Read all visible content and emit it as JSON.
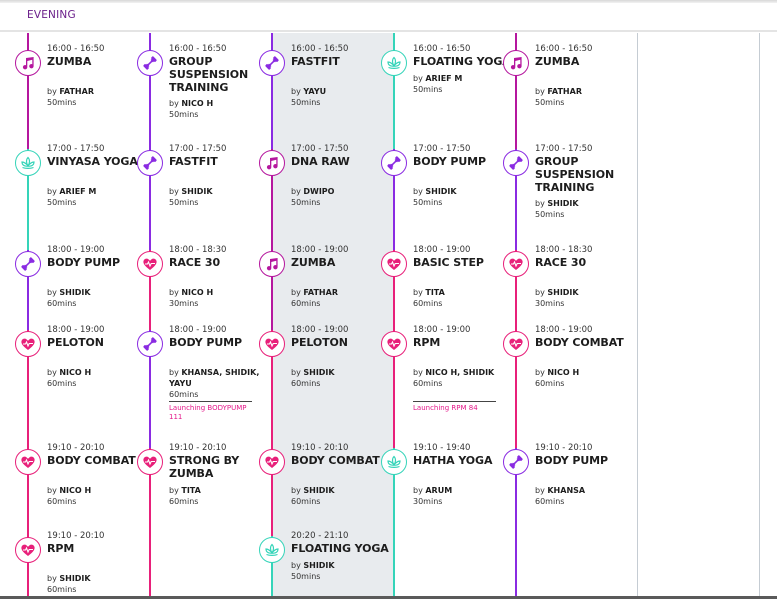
{
  "section": {
    "label": "EVENING"
  },
  "colors": {
    "pink": "#e8207a",
    "purple": "#8a2be2",
    "teal": "#35d4b9",
    "magenta": "#b5179e",
    "column_line": "#aab5c0",
    "highlight": "#e8ebee",
    "promo": "#e4188a"
  },
  "columns": [
    {
      "highlighted": false,
      "classes": [
        {
          "time": "16:00 - 16:50",
          "name": "ZUMBA",
          "by_prefix": "by",
          "instructor": "FATHAR",
          "duration": "50mins",
          "icon": "music-note-icon",
          "color": "#b5179e"
        },
        {
          "time": "17:00 - 17:50",
          "name": "VINYASA YOGA",
          "by_prefix": "by",
          "instructor": "ARIEF M",
          "duration": "50mins",
          "icon": "lotus-icon",
          "color": "#35d4b9"
        },
        {
          "time": "18:00 - 19:00",
          "name": "BODY PUMP",
          "by_prefix": "by",
          "instructor": "SHIDIK",
          "duration": "60mins",
          "icon": "dumbbell-icon",
          "color": "#8a2be2"
        },
        {
          "time": "18:00 - 19:00",
          "name": "PELOTON",
          "by_prefix": "by",
          "instructor": "NICO H",
          "duration": "60mins",
          "icon": "heart-pulse-icon",
          "color": "#e8207a"
        },
        {
          "time": "19:10 - 20:10",
          "name": "BODY COMBAT",
          "by_prefix": "by",
          "instructor": "NICO H",
          "duration": "60mins",
          "icon": "heart-pulse-icon",
          "color": "#e8207a"
        },
        {
          "time": "19:10 - 20:10",
          "name": "RPM",
          "by_prefix": "by",
          "instructor": "SHIDIK",
          "duration": "60mins",
          "icon": "heart-pulse-icon",
          "color": "#e8207a"
        }
      ]
    },
    {
      "highlighted": false,
      "classes": [
        {
          "time": "16:00 - 16:50",
          "name": "GROUP SUSPENSION TRAINING",
          "by_prefix": "by",
          "instructor": "NICO H",
          "duration": "50mins",
          "icon": "dumbbell-icon",
          "color": "#8a2be2"
        },
        {
          "time": "17:00 - 17:50",
          "name": "FASTFIT",
          "by_prefix": "by",
          "instructor": "SHIDIK",
          "duration": "50mins",
          "icon": "dumbbell-icon",
          "color": "#8a2be2"
        },
        {
          "time": "18:00 - 18:30",
          "name": "RACE 30",
          "by_prefix": "by",
          "instructor": "NICO H",
          "duration": "30mins",
          "icon": "heart-pulse-icon",
          "color": "#e8207a"
        },
        {
          "time": "18:00 - 19:00",
          "name": "BODY PUMP",
          "by_prefix": "by",
          "instructor": "KHANSA, SHIDIK, YAYU",
          "duration": "60mins",
          "icon": "dumbbell-icon",
          "color": "#8a2be2",
          "promo": "Launching BODYPUMP 111"
        },
        {
          "time": "19:10 - 20:10",
          "name": "STRONG BY ZUMBA",
          "by_prefix": "by",
          "instructor": "TITA",
          "duration": "60mins",
          "icon": "heart-pulse-icon",
          "color": "#e8207a"
        }
      ]
    },
    {
      "highlighted": true,
      "classes": [
        {
          "time": "16:00 - 16:50",
          "name": "FASTFIT",
          "by_prefix": "by",
          "instructor": "YAYU",
          "duration": "50mins",
          "icon": "dumbbell-icon",
          "color": "#8a2be2"
        },
        {
          "time": "17:00 - 17:50",
          "name": "DNA RAW",
          "by_prefix": "by",
          "instructor": "DWIPO",
          "duration": "50mins",
          "icon": "music-note-icon",
          "color": "#b5179e"
        },
        {
          "time": "18:00 - 19:00",
          "name": "ZUMBA",
          "by_prefix": "by",
          "instructor": "FATHAR",
          "duration": "60mins",
          "icon": "music-note-icon",
          "color": "#b5179e"
        },
        {
          "time": "18:00 - 19:00",
          "name": "PELOTON",
          "by_prefix": "by",
          "instructor": "SHIDIK",
          "duration": "60mins",
          "icon": "heart-pulse-icon",
          "color": "#e8207a"
        },
        {
          "time": "19:10 - 20:10",
          "name": "BODY COMBAT",
          "by_prefix": "by",
          "instructor": "SHIDIK",
          "duration": "60mins",
          "icon": "heart-pulse-icon",
          "color": "#e8207a"
        },
        {
          "time": "20:20 - 21:10",
          "name": "FLOATING YOGA",
          "by_prefix": "by",
          "instructor": "SHIDIK",
          "duration": "50mins",
          "icon": "lotus-icon",
          "color": "#35d4b9"
        }
      ]
    },
    {
      "highlighted": false,
      "classes": [
        {
          "time": "16:00 - 16:50",
          "name": "FLOATING YOGA",
          "by_prefix": "by",
          "instructor": "ARIEF M",
          "duration": "50mins",
          "icon": "lotus-icon",
          "color": "#35d4b9"
        },
        {
          "time": "17:00 - 17:50",
          "name": "BODY PUMP",
          "by_prefix": "by",
          "instructor": "SHIDIK",
          "duration": "50mins",
          "icon": "dumbbell-icon",
          "color": "#8a2be2"
        },
        {
          "time": "18:00 - 19:00",
          "name": "BASIC STEP",
          "by_prefix": "by",
          "instructor": "TITA",
          "duration": "60mins",
          "icon": "heart-pulse-icon",
          "color": "#e8207a"
        },
        {
          "time": "18:00 - 19:00",
          "name": "RPM",
          "by_prefix": "by",
          "instructor": "NICO H, SHIDIK",
          "duration": "60mins",
          "icon": "heart-pulse-icon",
          "color": "#e8207a",
          "promo": "Launching RPM 84"
        },
        {
          "time": "19:10 - 19:40",
          "name": "HATHA YOGA",
          "by_prefix": "by",
          "instructor": "ARUM",
          "duration": "30mins",
          "icon": "lotus-icon",
          "color": "#35d4b9"
        }
      ]
    },
    {
      "highlighted": false,
      "classes": [
        {
          "time": "16:00 - 16:50",
          "name": "ZUMBA",
          "by_prefix": "by",
          "instructor": "FATHAR",
          "duration": "50mins",
          "icon": "music-note-icon",
          "color": "#b5179e"
        },
        {
          "time": "17:00 - 17:50",
          "name": "GROUP SUSPENSION TRAINING",
          "by_prefix": "by",
          "instructor": "SHIDIK",
          "duration": "50mins",
          "icon": "dumbbell-icon",
          "color": "#8a2be2"
        },
        {
          "time": "18:00 - 18:30",
          "name": "RACE 30",
          "by_prefix": "by",
          "instructor": "SHIDIK",
          "duration": "30mins",
          "icon": "heart-pulse-icon",
          "color": "#e8207a"
        },
        {
          "time": "18:00 - 19:00",
          "name": "BODY COMBAT",
          "by_prefix": "by",
          "instructor": "NICO H",
          "duration": "60mins",
          "icon": "heart-pulse-icon",
          "color": "#e8207a"
        },
        {
          "time": "19:10 - 20:10",
          "name": "BODY PUMP",
          "by_prefix": "by",
          "instructor": "KHANSA",
          "duration": "60mins",
          "icon": "dumbbell-icon",
          "color": "#8a2be2"
        }
      ]
    },
    {
      "highlighted": false,
      "classes": []
    },
    {
      "highlighted": false,
      "classes": []
    }
  ]
}
